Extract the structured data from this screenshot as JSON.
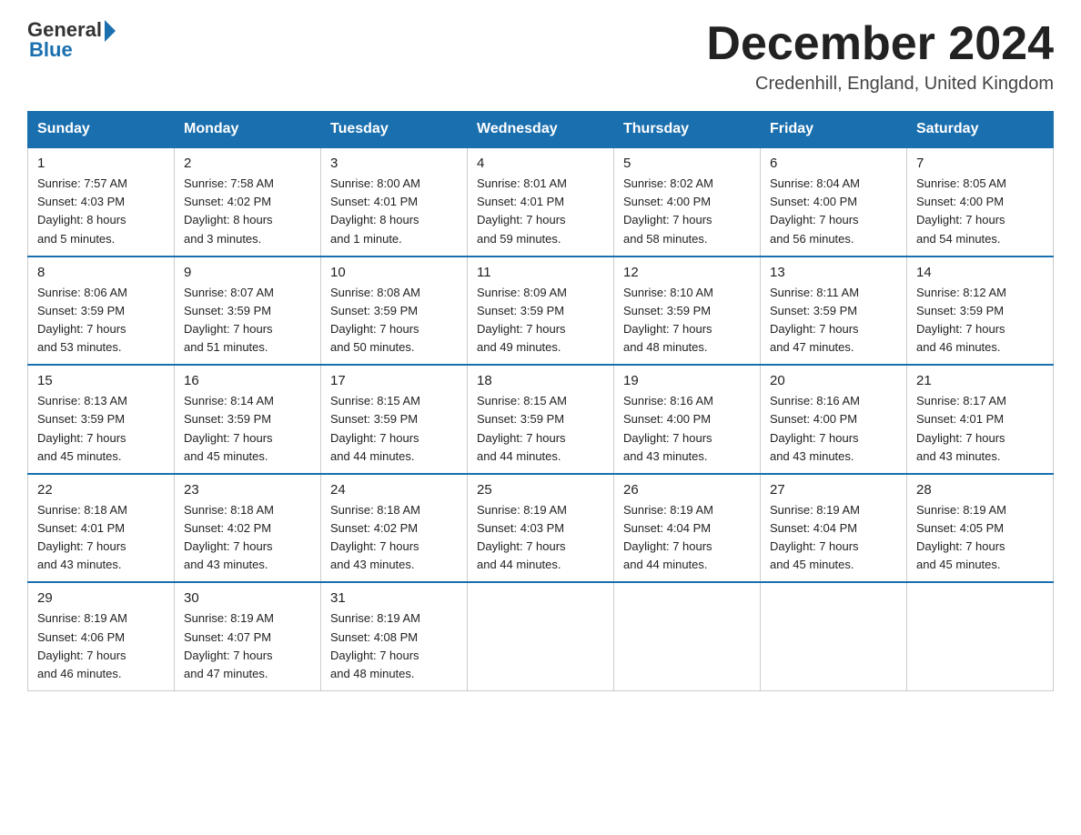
{
  "header": {
    "logo_general": "General",
    "logo_blue": "Blue",
    "month_title": "December 2024",
    "location": "Credenhill, England, United Kingdom"
  },
  "weekdays": [
    "Sunday",
    "Monday",
    "Tuesday",
    "Wednesday",
    "Thursday",
    "Friday",
    "Saturday"
  ],
  "weeks": [
    [
      {
        "day": "1",
        "sunrise": "7:57 AM",
        "sunset": "4:03 PM",
        "daylight": "8 hours and 5 minutes."
      },
      {
        "day": "2",
        "sunrise": "7:58 AM",
        "sunset": "4:02 PM",
        "daylight": "8 hours and 3 minutes."
      },
      {
        "day": "3",
        "sunrise": "8:00 AM",
        "sunset": "4:01 PM",
        "daylight": "8 hours and 1 minute."
      },
      {
        "day": "4",
        "sunrise": "8:01 AM",
        "sunset": "4:01 PM",
        "daylight": "7 hours and 59 minutes."
      },
      {
        "day": "5",
        "sunrise": "8:02 AM",
        "sunset": "4:00 PM",
        "daylight": "7 hours and 58 minutes."
      },
      {
        "day": "6",
        "sunrise": "8:04 AM",
        "sunset": "4:00 PM",
        "daylight": "7 hours and 56 minutes."
      },
      {
        "day": "7",
        "sunrise": "8:05 AM",
        "sunset": "4:00 PM",
        "daylight": "7 hours and 54 minutes."
      }
    ],
    [
      {
        "day": "8",
        "sunrise": "8:06 AM",
        "sunset": "3:59 PM",
        "daylight": "7 hours and 53 minutes."
      },
      {
        "day": "9",
        "sunrise": "8:07 AM",
        "sunset": "3:59 PM",
        "daylight": "7 hours and 51 minutes."
      },
      {
        "day": "10",
        "sunrise": "8:08 AM",
        "sunset": "3:59 PM",
        "daylight": "7 hours and 50 minutes."
      },
      {
        "day": "11",
        "sunrise": "8:09 AM",
        "sunset": "3:59 PM",
        "daylight": "7 hours and 49 minutes."
      },
      {
        "day": "12",
        "sunrise": "8:10 AM",
        "sunset": "3:59 PM",
        "daylight": "7 hours and 48 minutes."
      },
      {
        "day": "13",
        "sunrise": "8:11 AM",
        "sunset": "3:59 PM",
        "daylight": "7 hours and 47 minutes."
      },
      {
        "day": "14",
        "sunrise": "8:12 AM",
        "sunset": "3:59 PM",
        "daylight": "7 hours and 46 minutes."
      }
    ],
    [
      {
        "day": "15",
        "sunrise": "8:13 AM",
        "sunset": "3:59 PM",
        "daylight": "7 hours and 45 minutes."
      },
      {
        "day": "16",
        "sunrise": "8:14 AM",
        "sunset": "3:59 PM",
        "daylight": "7 hours and 45 minutes."
      },
      {
        "day": "17",
        "sunrise": "8:15 AM",
        "sunset": "3:59 PM",
        "daylight": "7 hours and 44 minutes."
      },
      {
        "day": "18",
        "sunrise": "8:15 AM",
        "sunset": "3:59 PM",
        "daylight": "7 hours and 44 minutes."
      },
      {
        "day": "19",
        "sunrise": "8:16 AM",
        "sunset": "4:00 PM",
        "daylight": "7 hours and 43 minutes."
      },
      {
        "day": "20",
        "sunrise": "8:16 AM",
        "sunset": "4:00 PM",
        "daylight": "7 hours and 43 minutes."
      },
      {
        "day": "21",
        "sunrise": "8:17 AM",
        "sunset": "4:01 PM",
        "daylight": "7 hours and 43 minutes."
      }
    ],
    [
      {
        "day": "22",
        "sunrise": "8:18 AM",
        "sunset": "4:01 PM",
        "daylight": "7 hours and 43 minutes."
      },
      {
        "day": "23",
        "sunrise": "8:18 AM",
        "sunset": "4:02 PM",
        "daylight": "7 hours and 43 minutes."
      },
      {
        "day": "24",
        "sunrise": "8:18 AM",
        "sunset": "4:02 PM",
        "daylight": "7 hours and 43 minutes."
      },
      {
        "day": "25",
        "sunrise": "8:19 AM",
        "sunset": "4:03 PM",
        "daylight": "7 hours and 44 minutes."
      },
      {
        "day": "26",
        "sunrise": "8:19 AM",
        "sunset": "4:04 PM",
        "daylight": "7 hours and 44 minutes."
      },
      {
        "day": "27",
        "sunrise": "8:19 AM",
        "sunset": "4:04 PM",
        "daylight": "7 hours and 45 minutes."
      },
      {
        "day": "28",
        "sunrise": "8:19 AM",
        "sunset": "4:05 PM",
        "daylight": "7 hours and 45 minutes."
      }
    ],
    [
      {
        "day": "29",
        "sunrise": "8:19 AM",
        "sunset": "4:06 PM",
        "daylight": "7 hours and 46 minutes."
      },
      {
        "day": "30",
        "sunrise": "8:19 AM",
        "sunset": "4:07 PM",
        "daylight": "7 hours and 47 minutes."
      },
      {
        "day": "31",
        "sunrise": "8:19 AM",
        "sunset": "4:08 PM",
        "daylight": "7 hours and 48 minutes."
      },
      null,
      null,
      null,
      null
    ]
  ],
  "labels": {
    "sunrise": "Sunrise:",
    "sunset": "Sunset:",
    "daylight": "Daylight:"
  }
}
